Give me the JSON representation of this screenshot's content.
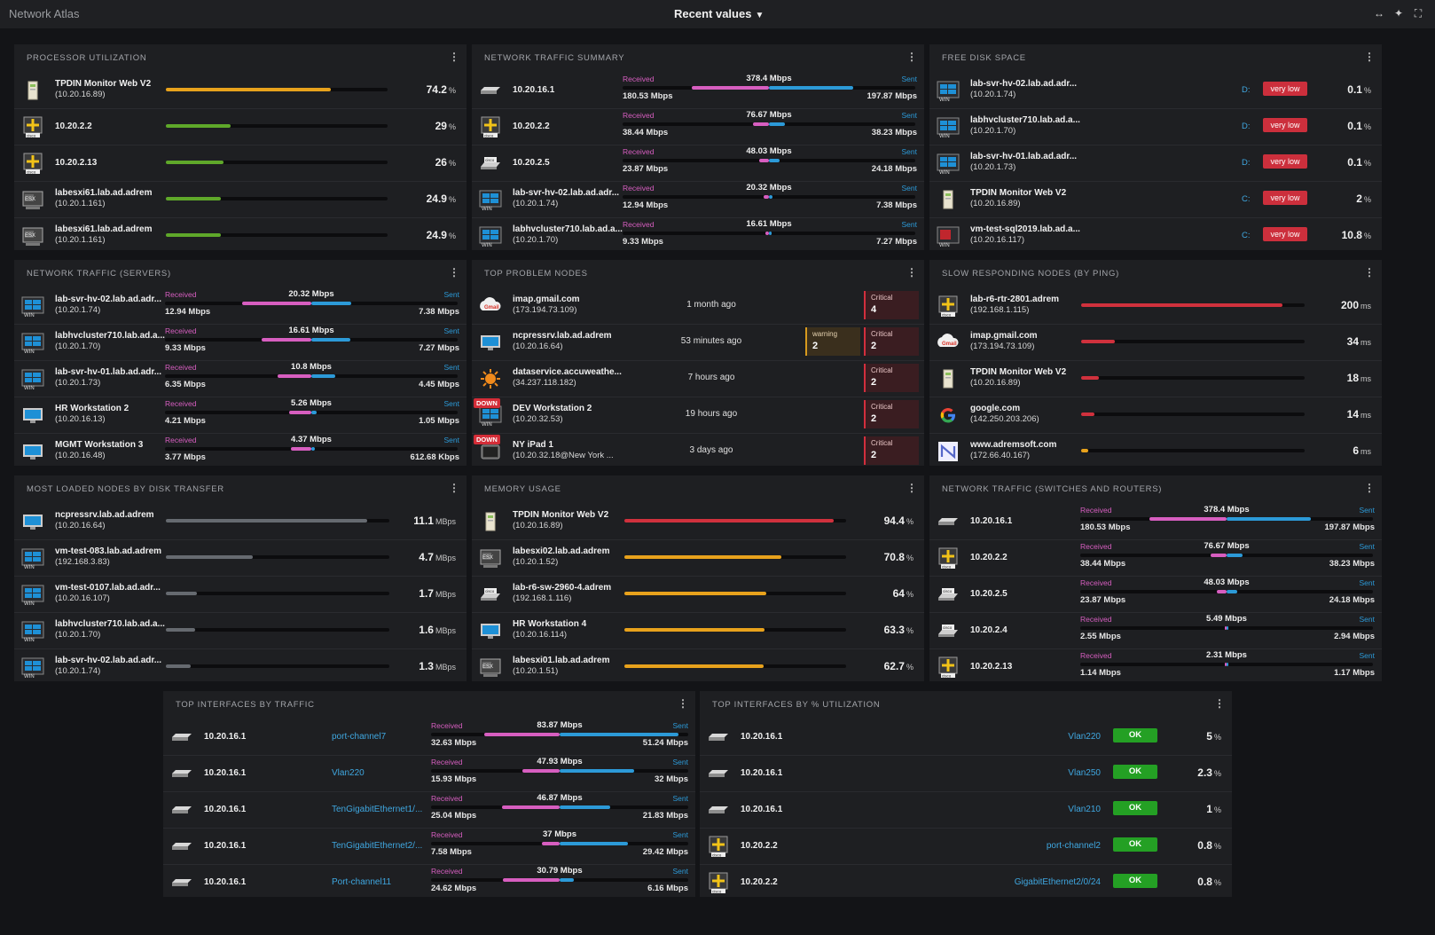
{
  "app_title": "Network Atlas",
  "view_title": "Recent values",
  "colors": {
    "received": "#d75ec0",
    "sent": "#2c9ad8",
    "orange": "#e8a21c",
    "green": "#5fa82a",
    "red": "#d0313d",
    "gray": "#666a70"
  },
  "panels": {
    "processor": {
      "title": "PROCESSOR UTILIZATION",
      "rows": [
        {
          "name": "TPDIN Monitor Web V2",
          "ip": "(10.20.16.89)",
          "icon": "tpdin",
          "value": "74.2",
          "unit": "%",
          "pct": 74.2,
          "color": "orange"
        },
        {
          "name": "10.20.2.2",
          "ip": "",
          "icon": "cisco",
          "value": "29",
          "unit": "%",
          "pct": 29,
          "color": "green"
        },
        {
          "name": "10.20.2.13",
          "ip": "",
          "icon": "cisco",
          "value": "26",
          "unit": "%",
          "pct": 26,
          "color": "green"
        },
        {
          "name": "labesxi61.lab.ad.adrem",
          "ip": "(10.20.1.161)",
          "icon": "esx",
          "value": "24.9",
          "unit": "%",
          "pct": 24.9,
          "color": "green"
        },
        {
          "name": "labesxi61.lab.ad.adrem",
          "ip": "(10.20.1.161)",
          "icon": "esx",
          "value": "24.9",
          "unit": "%",
          "pct": 24.9,
          "color": "green"
        }
      ]
    },
    "net_summary": {
      "title": "NETWORK TRAFFIC SUMMARY",
      "rows": [
        {
          "name": "10.20.16.1",
          "ip": "",
          "icon": "switch",
          "total": "378.4 Mbps",
          "recv": "180.53 Mbps",
          "sent": "197.87 Mbps",
          "r": 180.53,
          "s": 197.87
        },
        {
          "name": "10.20.2.2",
          "ip": "",
          "icon": "cisco",
          "total": "76.67 Mbps",
          "recv": "38.44 Mbps",
          "sent": "38.23 Mbps",
          "r": 38.44,
          "s": 38.23
        },
        {
          "name": "10.20.2.5",
          "ip": "",
          "icon": "ciscoswitch",
          "total": "48.03 Mbps",
          "recv": "23.87 Mbps",
          "sent": "24.18 Mbps",
          "r": 23.87,
          "s": 24.18
        },
        {
          "name": "lab-svr-hv-02.lab.ad.adr...",
          "ip": "(10.20.1.74)",
          "icon": "win",
          "total": "20.32 Mbps",
          "recv": "12.94 Mbps",
          "sent": "7.38 Mbps",
          "r": 12.94,
          "s": 7.38
        },
        {
          "name": "labhvcluster710.lab.ad.a...",
          "ip": "(10.20.1.70)",
          "icon": "win",
          "total": "16.61 Mbps",
          "recv": "9.33 Mbps",
          "sent": "7.27 Mbps",
          "r": 9.33,
          "s": 7.27
        }
      ],
      "max": 378.4
    },
    "disk_free": {
      "title": "FREE DISK SPACE",
      "rows": [
        {
          "name": "lab-svr-hv-02.lab.ad.adr...",
          "ip": "(10.20.1.74)",
          "icon": "win",
          "drive": "D:",
          "badge": "very low",
          "value": "0.1",
          "unit": "%"
        },
        {
          "name": "labhvcluster710.lab.ad.a...",
          "ip": "(10.20.1.70)",
          "icon": "win",
          "drive": "D:",
          "badge": "very low",
          "value": "0.1",
          "unit": "%"
        },
        {
          "name": "lab-svr-hv-01.lab.ad.adr...",
          "ip": "(10.20.1.73)",
          "icon": "win",
          "drive": "D:",
          "badge": "very low",
          "value": "0.1",
          "unit": "%"
        },
        {
          "name": "TPDIN Monitor Web V2",
          "ip": "(10.20.16.89)",
          "icon": "tpdin",
          "drive": "C:",
          "badge": "very low",
          "value": "2",
          "unit": "%"
        },
        {
          "name": "vm-test-sql2019.lab.ad.a...",
          "ip": "(10.20.16.117)",
          "icon": "sql",
          "drive": "C:",
          "badge": "very low",
          "value": "10.8",
          "unit": "%"
        }
      ]
    },
    "net_servers": {
      "title": "NETWORK TRAFFIC (SERVERS)",
      "rows": [
        {
          "name": "lab-svr-hv-02.lab.ad.adr...",
          "ip": "(10.20.1.74)",
          "icon": "win",
          "total": "20.32 Mbps",
          "recv": "12.94 Mbps",
          "sent": "7.38 Mbps",
          "r": 12.94,
          "s": 7.38
        },
        {
          "name": "labhvcluster710.lab.ad.a...",
          "ip": "(10.20.1.70)",
          "icon": "win",
          "total": "16.61 Mbps",
          "recv": "9.33 Mbps",
          "sent": "7.27 Mbps",
          "r": 9.33,
          "s": 7.27
        },
        {
          "name": "lab-svr-hv-01.lab.ad.adr...",
          "ip": "(10.20.1.73)",
          "icon": "win",
          "total": "10.8 Mbps",
          "recv": "6.35 Mbps",
          "sent": "4.45 Mbps",
          "r": 6.35,
          "s": 4.45
        },
        {
          "name": "HR Workstation 2",
          "ip": "(10.20.16.13)",
          "icon": "monitor",
          "total": "5.26 Mbps",
          "recv": "4.21 Mbps",
          "sent": "1.05 Mbps",
          "r": 4.21,
          "s": 1.05
        },
        {
          "name": "MGMT Workstation 3",
          "ip": "(10.20.16.48)",
          "icon": "monitor",
          "total": "4.37 Mbps",
          "recv": "3.77 Mbps",
          "sent": "612.68 Kbps",
          "r": 3.77,
          "s": 0.61
        }
      ],
      "max": 30
    },
    "problems": {
      "title": "TOP PROBLEM NODES",
      "rows": [
        {
          "name": "imap.gmail.com",
          "ip": "(173.194.73.109)",
          "icon": "gmail",
          "ago": "1 month ago",
          "warning": "",
          "critical": "4",
          "down": ""
        },
        {
          "name": "ncpressrv.lab.ad.adrem",
          "ip": "(10.20.16.64)",
          "icon": "monitor",
          "ago": "53 minutes ago",
          "warning": "2",
          "critical": "2",
          "down": ""
        },
        {
          "name": "dataservice.accuweathe...",
          "ip": "(34.237.118.182)",
          "icon": "sun",
          "ago": "7 hours ago",
          "warning": "",
          "critical": "2",
          "down": ""
        },
        {
          "name": "DEV Workstation 2",
          "ip": "(10.20.32.53)",
          "icon": "win",
          "ago": "19 hours ago",
          "warning": "",
          "critical": "2",
          "down": "DOWN"
        },
        {
          "name": "NY iPad 1",
          "ip": "(10.20.32.18@New York ...",
          "icon": "tablet",
          "ago": "3 days ago",
          "warning": "",
          "critical": "2",
          "down": "DOWN"
        }
      ],
      "warning_label": "warning",
      "critical_label": "Critical"
    },
    "slow": {
      "title": "SLOW RESPONDING NODES (BY PING)",
      "rows": [
        {
          "name": "lab-r6-rtr-2801.adrem",
          "ip": "(192.168.1.115)",
          "icon": "cisco",
          "value": "200",
          "unit": "ms",
          "pct": 90,
          "color": "red"
        },
        {
          "name": "imap.gmail.com",
          "ip": "(173.194.73.109)",
          "icon": "gmail",
          "value": "34",
          "unit": "ms",
          "pct": 15,
          "color": "red"
        },
        {
          "name": "TPDIN Monitor Web V2",
          "ip": "(10.20.16.89)",
          "icon": "tpdin",
          "value": "18",
          "unit": "ms",
          "pct": 8,
          "color": "red"
        },
        {
          "name": "google.com",
          "ip": "(142.250.203.206)",
          "icon": "google",
          "value": "14",
          "unit": "ms",
          "pct": 6,
          "color": "red"
        },
        {
          "name": "www.adremsoft.com",
          "ip": "(172.66.40.167)",
          "icon": "nc",
          "value": "6",
          "unit": "ms",
          "pct": 3,
          "color": "orange"
        }
      ]
    },
    "disk_transfer": {
      "title": "MOST LOADED NODES BY DISK TRANSFER",
      "rows": [
        {
          "name": "ncpressrv.lab.ad.adrem",
          "ip": "(10.20.16.64)",
          "icon": "monitor",
          "value": "11.1",
          "unit": "MBps",
          "pct": 90,
          "color": "gray"
        },
        {
          "name": "vm-test-083.lab.ad.adrem",
          "ip": "(192.168.3.83)",
          "icon": "win",
          "value": "4.7",
          "unit": "MBps",
          "pct": 39,
          "color": "gray"
        },
        {
          "name": "vm-test-0107.lab.ad.adr...",
          "ip": "(10.20.16.107)",
          "icon": "win",
          "value": "1.7",
          "unit": "MBps",
          "pct": 14,
          "color": "gray"
        },
        {
          "name": "labhvcluster710.lab.ad.a...",
          "ip": "(10.20.1.70)",
          "icon": "win",
          "value": "1.6",
          "unit": "MBps",
          "pct": 13,
          "color": "gray"
        },
        {
          "name": "lab-svr-hv-02.lab.ad.adr...",
          "ip": "(10.20.1.74)",
          "icon": "win",
          "value": "1.3",
          "unit": "MBps",
          "pct": 11,
          "color": "gray"
        }
      ]
    },
    "memory": {
      "title": "MEMORY USAGE",
      "rows": [
        {
          "name": "TPDIN Monitor Web V2",
          "ip": "(10.20.16.89)",
          "icon": "tpdin",
          "value": "94.4",
          "unit": "%",
          "pct": 94.4,
          "color": "red"
        },
        {
          "name": "labesxi02.lab.ad.adrem",
          "ip": "(10.20.1.52)",
          "icon": "esx",
          "value": "70.8",
          "unit": "%",
          "pct": 70.8,
          "color": "orange"
        },
        {
          "name": "lab-r6-sw-2960-4.adrem",
          "ip": "(192.168.1.116)",
          "icon": "ciscoswitch",
          "value": "64",
          "unit": "%",
          "pct": 64,
          "color": "orange"
        },
        {
          "name": "HR Workstation 4",
          "ip": "(10.20.16.114)",
          "icon": "monitor",
          "value": "63.3",
          "unit": "%",
          "pct": 63.3,
          "color": "orange"
        },
        {
          "name": "labesxi01.lab.ad.adrem",
          "ip": "(10.20.1.51)",
          "icon": "esx",
          "value": "62.7",
          "unit": "%",
          "pct": 62.7,
          "color": "orange"
        }
      ]
    },
    "net_switches": {
      "title": "NETWORK TRAFFIC (SWITCHES AND ROUTERS)",
      "rows": [
        {
          "name": "10.20.16.1",
          "ip": "",
          "icon": "switch",
          "total": "378.4 Mbps",
          "recv": "180.53 Mbps",
          "sent": "197.87 Mbps",
          "r": 180.53,
          "s": 197.87
        },
        {
          "name": "10.20.2.2",
          "ip": "",
          "icon": "cisco",
          "total": "76.67 Mbps",
          "recv": "38.44 Mbps",
          "sent": "38.23 Mbps",
          "r": 38.44,
          "s": 38.23
        },
        {
          "name": "10.20.2.5",
          "ip": "",
          "icon": "ciscoswitch",
          "total": "48.03 Mbps",
          "recv": "23.87 Mbps",
          "sent": "24.18 Mbps",
          "r": 23.87,
          "s": 24.18
        },
        {
          "name": "10.20.2.4",
          "ip": "",
          "icon": "ciscoswitch",
          "total": "5.49 Mbps",
          "recv": "2.55 Mbps",
          "sent": "2.94 Mbps",
          "r": 2.55,
          "s": 2.94
        },
        {
          "name": "10.20.2.13",
          "ip": "",
          "icon": "cisco",
          "total": "2.31 Mbps",
          "recv": "1.14 Mbps",
          "sent": "1.17 Mbps",
          "r": 1.14,
          "s": 1.17
        }
      ],
      "max": 378.4
    },
    "if_traffic": {
      "title": "TOP INTERFACES BY TRAFFIC",
      "rows": [
        {
          "name": "10.20.16.1",
          "icon": "switch",
          "iface": "port-channel7",
          "total": "83.87 Mbps",
          "recv": "32.63 Mbps",
          "sent": "51.24 Mbps",
          "r": 32.63,
          "s": 51.24
        },
        {
          "name": "10.20.16.1",
          "icon": "switch",
          "iface": "Vlan220",
          "total": "47.93 Mbps",
          "recv": "15.93 Mbps",
          "sent": "32 Mbps",
          "r": 15.93,
          "s": 32
        },
        {
          "name": "10.20.16.1",
          "icon": "switch",
          "iface": "TenGigabitEthernet1/...",
          "total": "46.87 Mbps",
          "recv": "25.04 Mbps",
          "sent": "21.83 Mbps",
          "r": 25.04,
          "s": 21.83
        },
        {
          "name": "10.20.16.1",
          "icon": "switch",
          "iface": "TenGigabitEthernet2/...",
          "total": "37 Mbps",
          "recv": "7.58 Mbps",
          "sent": "29.42 Mbps",
          "r": 7.58,
          "s": 29.42
        },
        {
          "name": "10.20.16.1",
          "icon": "switch",
          "iface": "Port-channel11",
          "total": "30.79 Mbps",
          "recv": "24.62 Mbps",
          "sent": "6.16 Mbps",
          "r": 24.62,
          "s": 6.16
        }
      ],
      "max": 100
    },
    "if_util": {
      "title": "TOP INTERFACES BY % UTILIZATION",
      "rows": [
        {
          "name": "10.20.16.1",
          "icon": "switch",
          "iface": "Vlan220",
          "status": "OK",
          "value": "5",
          "unit": "%"
        },
        {
          "name": "10.20.16.1",
          "icon": "switch",
          "iface": "Vlan250",
          "status": "OK",
          "value": "2.3",
          "unit": "%"
        },
        {
          "name": "10.20.16.1",
          "icon": "switch",
          "iface": "Vlan210",
          "status": "OK",
          "value": "1",
          "unit": "%"
        },
        {
          "name": "10.20.2.2",
          "icon": "cisco",
          "iface": "port-channel2",
          "status": "OK",
          "value": "0.8",
          "unit": "%"
        },
        {
          "name": "10.20.2.2",
          "icon": "cisco",
          "iface": "GigabitEthernet2/0/24",
          "status": "OK",
          "value": "0.8",
          "unit": "%"
        }
      ]
    }
  },
  "labels": {
    "received": "Received",
    "sent": "Sent",
    "menu": "⋮"
  }
}
